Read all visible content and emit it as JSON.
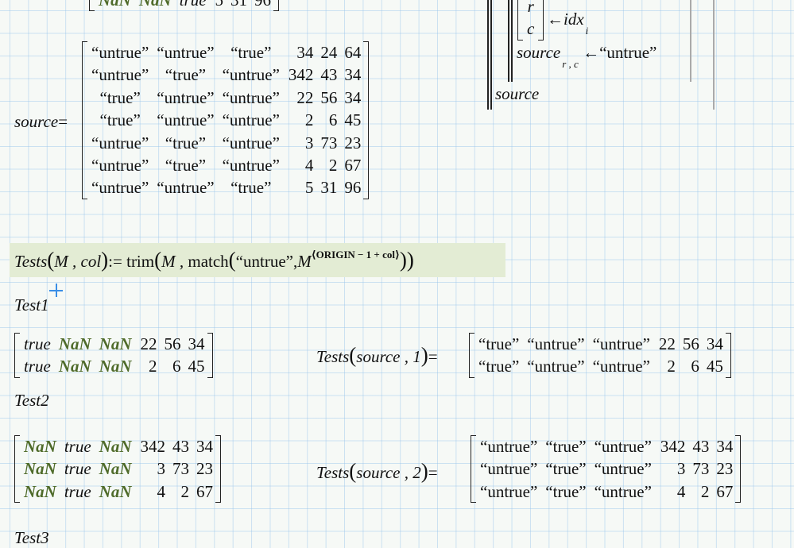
{
  "top_partial_row": [
    "NaN",
    "NaN",
    "true",
    "5",
    "31",
    "96"
  ],
  "program": {
    "vec": [
      "r",
      "c"
    ],
    "arrow": "←",
    "idx": "idx",
    "idx_sub": "i",
    "source": "source",
    "source_sub": "r , c",
    "assign_value": "“untrue”",
    "return": "source"
  },
  "source_label": "source",
  "eq": "=",
  "source_matrix": [
    [
      "“untrue”",
      "“untrue”",
      "“true”",
      "34",
      "24",
      "64"
    ],
    [
      "“untrue”",
      "“true”",
      "“untrue”",
      "342",
      "43",
      "34"
    ],
    [
      "“true”",
      "“untrue”",
      "“untrue”",
      "22",
      "56",
      "34"
    ],
    [
      "“true”",
      "“untrue”",
      "“untrue”",
      "2",
      "6",
      "45"
    ],
    [
      "“untrue”",
      "“true”",
      "“untrue”",
      "3",
      "73",
      "23"
    ],
    [
      "“untrue”",
      "“true”",
      "“untrue”",
      "4",
      "2",
      "67"
    ],
    [
      "“untrue”",
      "“untrue”",
      "“true”",
      "5",
      "31",
      "96"
    ]
  ],
  "definition": {
    "name": "Tests",
    "args": "M , col",
    "assign": ":=",
    "fn": "trim",
    "m": "M ,",
    "match": "match",
    "str": "“untrue”,",
    "M": "M",
    "sup": "⟨ORIGIN − 1 + col⟩",
    "highlight_color": "#e3ecd4"
  },
  "test1": {
    "label": "Test1",
    "expected": [
      [
        "true",
        "NaN",
        "NaN",
        "22",
        "56",
        "34"
      ],
      [
        "true",
        "NaN",
        "NaN",
        "2",
        "6",
        "45"
      ]
    ],
    "call": "Tests",
    "call_args": "source , 1",
    "result": [
      [
        "“true”",
        "“untrue”",
        "“untrue”",
        "22",
        "56",
        "34"
      ],
      [
        "“true”",
        "“untrue”",
        "“untrue”",
        "2",
        "6",
        "45"
      ]
    ]
  },
  "test2": {
    "label": "Test2",
    "expected": [
      [
        "NaN",
        "true",
        "NaN",
        "342",
        "43",
        "34"
      ],
      [
        "NaN",
        "true",
        "NaN",
        "3",
        "73",
        "23"
      ],
      [
        "NaN",
        "true",
        "NaN",
        "4",
        "2",
        "67"
      ]
    ],
    "call": "Tests",
    "call_args": "source , 2",
    "result": [
      [
        "“untrue”",
        "“true”",
        "“untrue”",
        "342",
        "43",
        "34"
      ],
      [
        "“untrue”",
        "“true”",
        "“untrue”",
        "3",
        "73",
        "23"
      ],
      [
        "“untrue”",
        "“true”",
        "“untrue”",
        "4",
        "2",
        "67"
      ]
    ]
  },
  "test3": {
    "label": "Test3"
  },
  "colors": {
    "nan_green": "#4f6b2a",
    "grid": "#a8cdee",
    "cursor": "#3a8ee6"
  }
}
